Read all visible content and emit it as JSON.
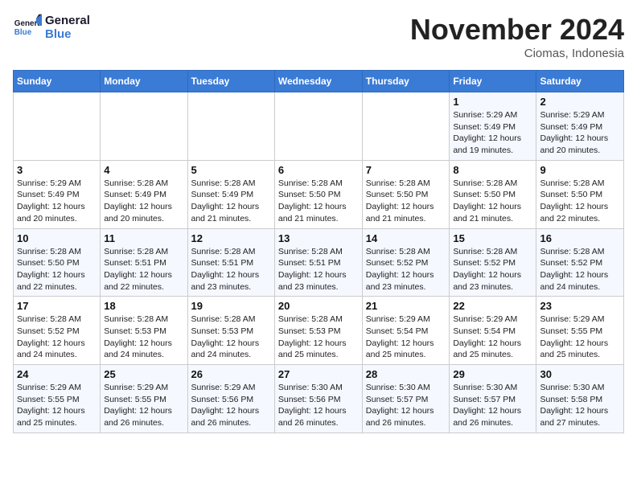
{
  "header": {
    "logo_line1": "General",
    "logo_line2": "Blue",
    "month": "November 2024",
    "location": "Ciomas, Indonesia"
  },
  "weekdays": [
    "Sunday",
    "Monday",
    "Tuesday",
    "Wednesday",
    "Thursday",
    "Friday",
    "Saturday"
  ],
  "weeks": [
    [
      {
        "day": "",
        "info": ""
      },
      {
        "day": "",
        "info": ""
      },
      {
        "day": "",
        "info": ""
      },
      {
        "day": "",
        "info": ""
      },
      {
        "day": "",
        "info": ""
      },
      {
        "day": "1",
        "info": "Sunrise: 5:29 AM\nSunset: 5:49 PM\nDaylight: 12 hours\nand 19 minutes."
      },
      {
        "day": "2",
        "info": "Sunrise: 5:29 AM\nSunset: 5:49 PM\nDaylight: 12 hours\nand 20 minutes."
      }
    ],
    [
      {
        "day": "3",
        "info": "Sunrise: 5:29 AM\nSunset: 5:49 PM\nDaylight: 12 hours\nand 20 minutes."
      },
      {
        "day": "4",
        "info": "Sunrise: 5:28 AM\nSunset: 5:49 PM\nDaylight: 12 hours\nand 20 minutes."
      },
      {
        "day": "5",
        "info": "Sunrise: 5:28 AM\nSunset: 5:49 PM\nDaylight: 12 hours\nand 21 minutes."
      },
      {
        "day": "6",
        "info": "Sunrise: 5:28 AM\nSunset: 5:50 PM\nDaylight: 12 hours\nand 21 minutes."
      },
      {
        "day": "7",
        "info": "Sunrise: 5:28 AM\nSunset: 5:50 PM\nDaylight: 12 hours\nand 21 minutes."
      },
      {
        "day": "8",
        "info": "Sunrise: 5:28 AM\nSunset: 5:50 PM\nDaylight: 12 hours\nand 21 minutes."
      },
      {
        "day": "9",
        "info": "Sunrise: 5:28 AM\nSunset: 5:50 PM\nDaylight: 12 hours\nand 22 minutes."
      }
    ],
    [
      {
        "day": "10",
        "info": "Sunrise: 5:28 AM\nSunset: 5:50 PM\nDaylight: 12 hours\nand 22 minutes."
      },
      {
        "day": "11",
        "info": "Sunrise: 5:28 AM\nSunset: 5:51 PM\nDaylight: 12 hours\nand 22 minutes."
      },
      {
        "day": "12",
        "info": "Sunrise: 5:28 AM\nSunset: 5:51 PM\nDaylight: 12 hours\nand 23 minutes."
      },
      {
        "day": "13",
        "info": "Sunrise: 5:28 AM\nSunset: 5:51 PM\nDaylight: 12 hours\nand 23 minutes."
      },
      {
        "day": "14",
        "info": "Sunrise: 5:28 AM\nSunset: 5:52 PM\nDaylight: 12 hours\nand 23 minutes."
      },
      {
        "day": "15",
        "info": "Sunrise: 5:28 AM\nSunset: 5:52 PM\nDaylight: 12 hours\nand 23 minutes."
      },
      {
        "day": "16",
        "info": "Sunrise: 5:28 AM\nSunset: 5:52 PM\nDaylight: 12 hours\nand 24 minutes."
      }
    ],
    [
      {
        "day": "17",
        "info": "Sunrise: 5:28 AM\nSunset: 5:52 PM\nDaylight: 12 hours\nand 24 minutes."
      },
      {
        "day": "18",
        "info": "Sunrise: 5:28 AM\nSunset: 5:53 PM\nDaylight: 12 hours\nand 24 minutes."
      },
      {
        "day": "19",
        "info": "Sunrise: 5:28 AM\nSunset: 5:53 PM\nDaylight: 12 hours\nand 24 minutes."
      },
      {
        "day": "20",
        "info": "Sunrise: 5:28 AM\nSunset: 5:53 PM\nDaylight: 12 hours\nand 25 minutes."
      },
      {
        "day": "21",
        "info": "Sunrise: 5:29 AM\nSunset: 5:54 PM\nDaylight: 12 hours\nand 25 minutes."
      },
      {
        "day": "22",
        "info": "Sunrise: 5:29 AM\nSunset: 5:54 PM\nDaylight: 12 hours\nand 25 minutes."
      },
      {
        "day": "23",
        "info": "Sunrise: 5:29 AM\nSunset: 5:55 PM\nDaylight: 12 hours\nand 25 minutes."
      }
    ],
    [
      {
        "day": "24",
        "info": "Sunrise: 5:29 AM\nSunset: 5:55 PM\nDaylight: 12 hours\nand 25 minutes."
      },
      {
        "day": "25",
        "info": "Sunrise: 5:29 AM\nSunset: 5:55 PM\nDaylight: 12 hours\nand 26 minutes."
      },
      {
        "day": "26",
        "info": "Sunrise: 5:29 AM\nSunset: 5:56 PM\nDaylight: 12 hours\nand 26 minutes."
      },
      {
        "day": "27",
        "info": "Sunrise: 5:30 AM\nSunset: 5:56 PM\nDaylight: 12 hours\nand 26 minutes."
      },
      {
        "day": "28",
        "info": "Sunrise: 5:30 AM\nSunset: 5:57 PM\nDaylight: 12 hours\nand 26 minutes."
      },
      {
        "day": "29",
        "info": "Sunrise: 5:30 AM\nSunset: 5:57 PM\nDaylight: 12 hours\nand 26 minutes."
      },
      {
        "day": "30",
        "info": "Sunrise: 5:30 AM\nSunset: 5:58 PM\nDaylight: 12 hours\nand 27 minutes."
      }
    ]
  ]
}
